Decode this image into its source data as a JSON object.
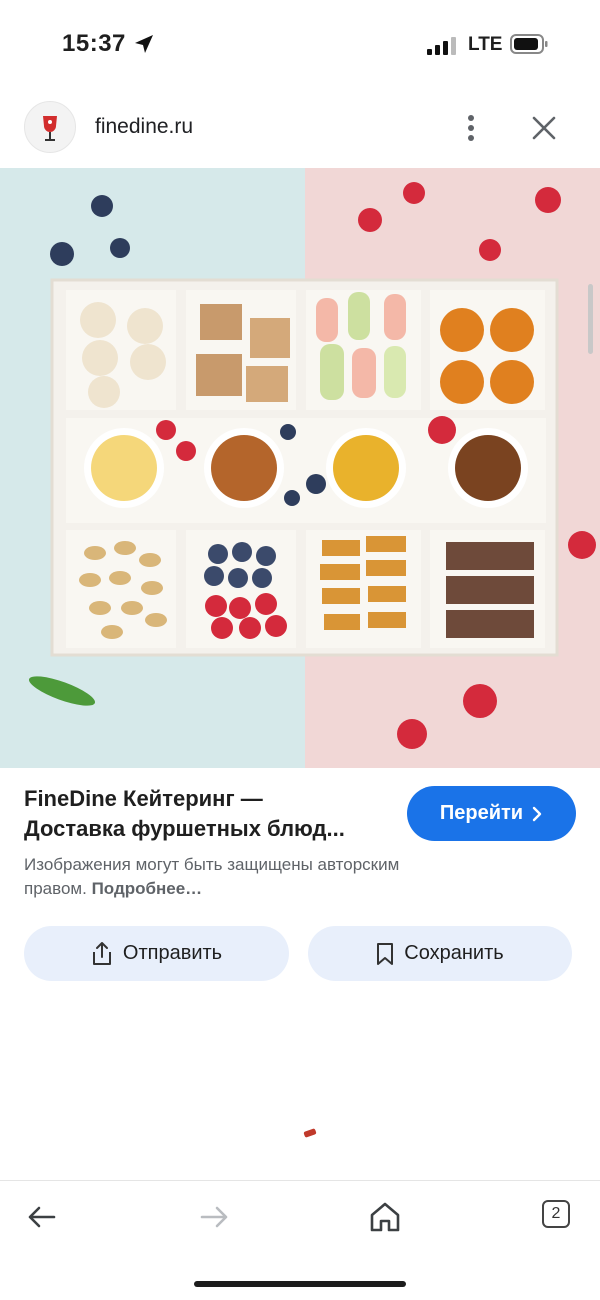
{
  "status_bar": {
    "time": "15:37",
    "network": "LTE"
  },
  "header": {
    "domain": "finedine.ru",
    "more_icon": "more-vert-icon",
    "close_icon": "close-icon"
  },
  "result": {
    "title_line1": "FineDine Кейтеринг —",
    "title_line2": "Доставка фуршетных блюд...",
    "goto_label": "Перейти",
    "copyright_text": "Изображения могут быть защищены авторским правом.",
    "copyright_link": "Подробнее…",
    "share_label": "Отправить",
    "save_label": "Сохранить"
  },
  "toolbar": {
    "tabs_count": "2"
  },
  "colors": {
    "accent": "#1a73e8",
    "secondary_bg": "#e8effb",
    "hero_left": "#d6e9ea",
    "hero_right": "#f1d7d6"
  }
}
